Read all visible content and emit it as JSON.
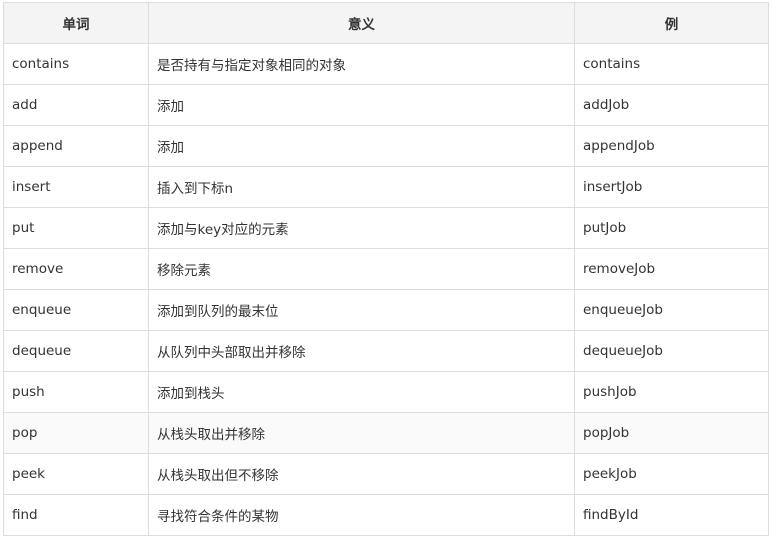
{
  "table": {
    "headers": [
      "单词",
      "意义",
      "例"
    ],
    "rows": [
      {
        "word": "contains",
        "meaning": "是否持有与指定对象相同的对象",
        "example": "contains"
      },
      {
        "word": "add",
        "meaning": "添加",
        "example": "addJob"
      },
      {
        "word": "append",
        "meaning": "添加",
        "example": "appendJob"
      },
      {
        "word": "insert",
        "meaning": "插入到下标n",
        "example": "insertJob"
      },
      {
        "word": "put",
        "meaning": "添加与key对应的元素",
        "example": "putJob"
      },
      {
        "word": "remove",
        "meaning": "移除元素",
        "example": "removeJob"
      },
      {
        "word": "enqueue",
        "meaning": "添加到队列的最末位",
        "example": "enqueueJob"
      },
      {
        "word": "dequeue",
        "meaning": "从队列中头部取出并移除",
        "example": "dequeueJob"
      },
      {
        "word": "push",
        "meaning": "添加到栈头",
        "example": "pushJob"
      },
      {
        "word": "pop",
        "meaning": "从栈头取出并移除",
        "example": "popJob"
      },
      {
        "word": "peek",
        "meaning": "从栈头取出但不移除",
        "example": "peekJob"
      },
      {
        "word": "find",
        "meaning": "寻找符合条件的某物",
        "example": "findById"
      }
    ]
  },
  "colors": {
    "header_bg": "#f4f4f4",
    "border": "#dddddd",
    "alt_row_bg": "#fafafa",
    "text": "#333333"
  }
}
